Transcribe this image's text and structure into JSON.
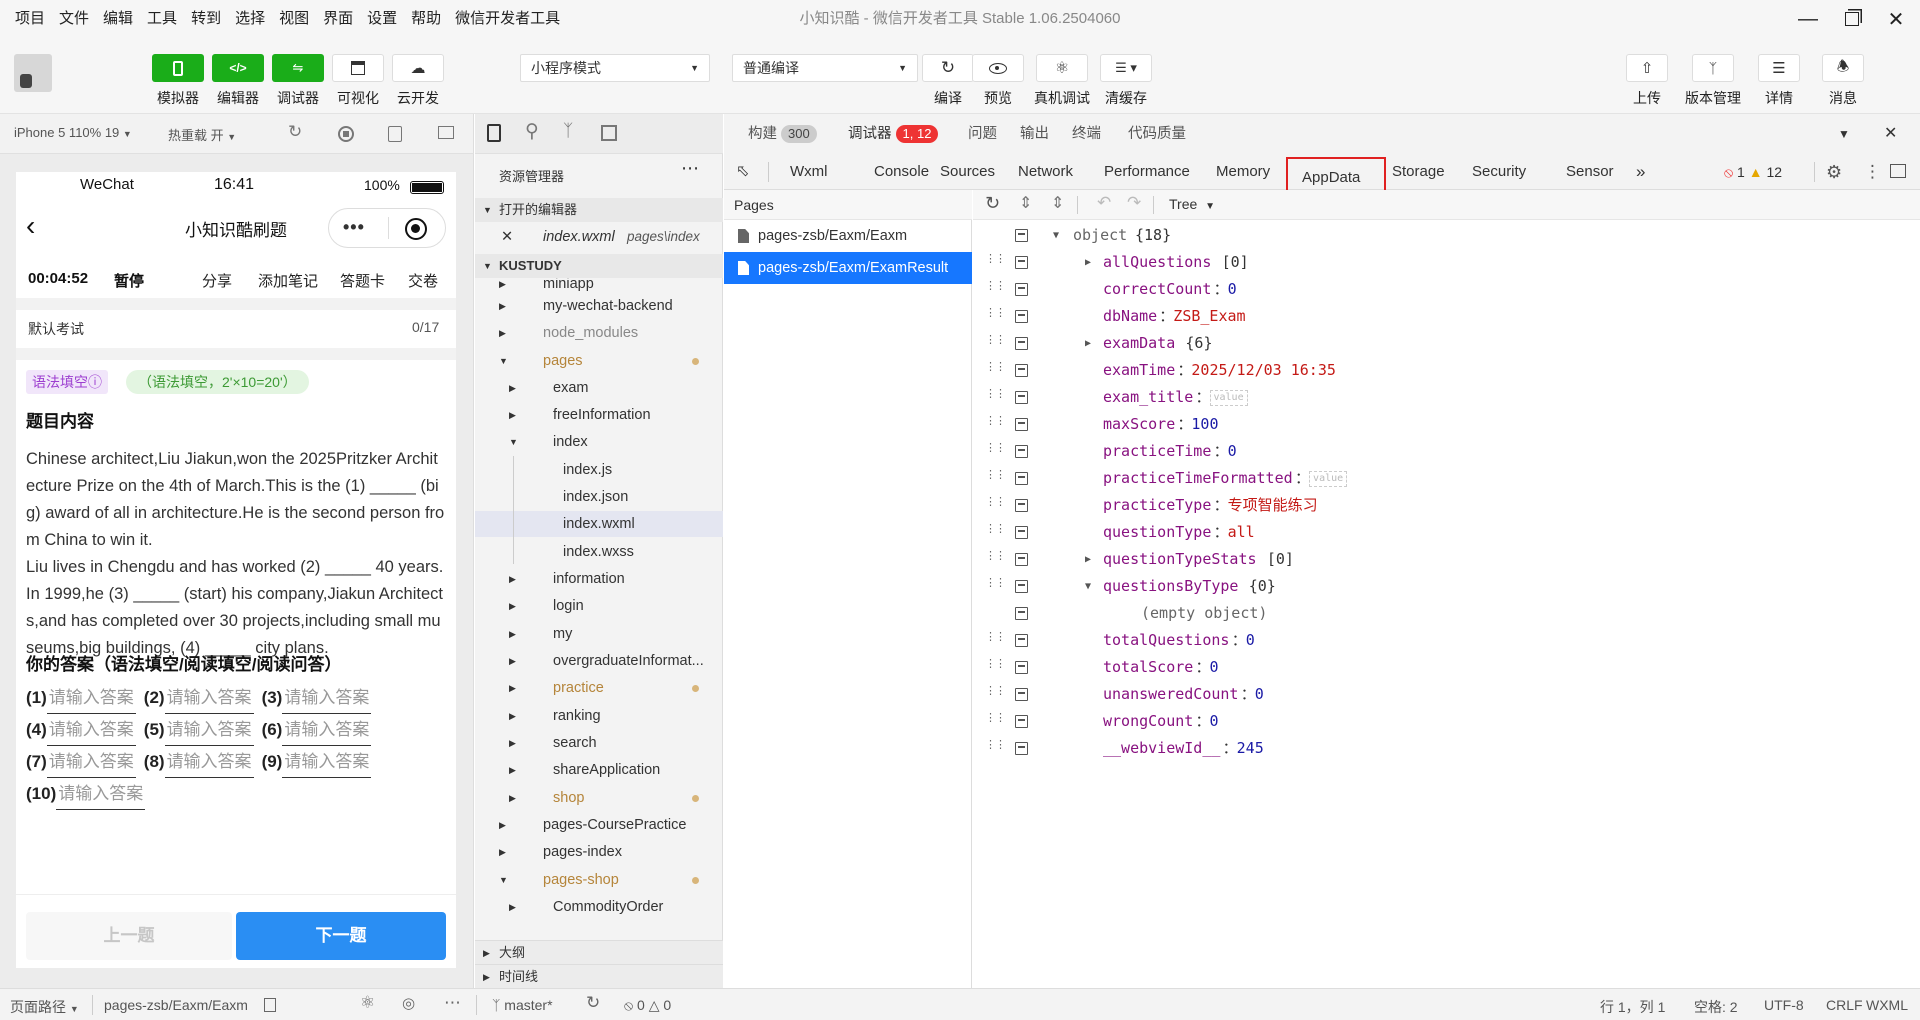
{
  "app": {
    "title": "小知识酷 - 微信开发者工具 Stable 1.06.2504060",
    "menu": [
      "项目",
      "文件",
      "编辑",
      "工具",
      "转到",
      "选择",
      "视图",
      "界面",
      "设置",
      "帮助",
      "微信开发者工具"
    ]
  },
  "toolbar": {
    "left_buttons": [
      "模拟器",
      "编辑器",
      "调试器",
      "可视化",
      "云开发"
    ],
    "mode_select": "小程序模式",
    "compile_select": "普通编译",
    "mid_buttons": [
      "编译",
      "预览",
      "真机调试",
      "清缓存"
    ],
    "right_buttons": [
      "上传",
      "版本管理",
      "详情",
      "消息"
    ]
  },
  "simulator_toolbar": {
    "device": "iPhone 5 110% 19",
    "hot_reload": "热重载 开"
  },
  "phone": {
    "status_app": "WeChat",
    "status_time": "16:41",
    "status_battery": "100%",
    "nav_title": "小知识酷刷题",
    "timer": "00:04:52",
    "pause": "暂停",
    "actions": [
      "分享",
      "添加笔记",
      "答题卡",
      "交卷"
    ],
    "exam_name": "默认考试",
    "exam_progress": "0/17",
    "tag_type": "语法填空ⓘ",
    "tag_desc": "（语法填空，2'×10=20'）",
    "content_heading": "题目内容",
    "para1": "Chinese architect,Liu Jiakun,won the 2025Pritzker Architecture Prize on the 4th of March.This is the (1) _____ (big) award of all in architecture.He is the second person from China to win it.",
    "para2": "Liu lives in Chengdu and has worked (2) _____ 40 years.In 1999,he (3) _____ (start) his company,Jiakun Architects,and has completed over 30 projects,including small museums,big buildings, (4) _____ city plans.",
    "answer_heading": "你的答案（语法填空/阅读填空/阅读问答）",
    "answer_placeholder": "请输入答案",
    "answer_numbers": [
      "(1)",
      "(2)",
      "(3)",
      "(4)",
      "(5)",
      "(6)",
      "(7)",
      "(8)",
      "(9)",
      "(10)"
    ],
    "prev_button": "上一题",
    "next_button": "下一题"
  },
  "explorer": {
    "title": "资源管理器",
    "open_editors": "打开的编辑器",
    "open_file": "index.wxml",
    "open_file_path": "pages\\index",
    "project": "KUSTUDY",
    "items": [
      "miniapp",
      "my-wechat-backend",
      "node_modules",
      "pages",
      "exam",
      "freeInformation",
      "index",
      "index.js",
      "index.json",
      "index.wxml",
      "index.wxss",
      "information",
      "login",
      "my",
      "overgraduateInformat...",
      "practice",
      "ranking",
      "search",
      "shareApplication",
      "shop",
      "pages-CoursePractice",
      "pages-index",
      "pages-shop",
      "CommodityOrder"
    ],
    "outline": "大纲",
    "timeline": "时间线"
  },
  "devtools": {
    "top_tabs": {
      "build": "构建",
      "build_count": "300",
      "debugger": "调试器",
      "debugger_badge": "1, 12",
      "issues": "问题",
      "output": "输出",
      "terminal": "终端",
      "quality": "代码质量"
    },
    "tabs": [
      "Wxml",
      "Console",
      "Sources",
      "Network",
      "Performance",
      "Memory",
      "AppData",
      "Storage",
      "Security",
      "Sensor"
    ],
    "active_tab": "AppData",
    "errors": "1",
    "warnings": "12",
    "pages_label": "Pages",
    "pages": [
      "pages-zsb/Eaxm/Eaxm",
      "pages-zsb/Eaxm/ExamResult"
    ],
    "view_mode": "Tree",
    "root": "object",
    "root_count": "{18}",
    "empty_object": "(empty object)",
    "value_placeholder": "value",
    "fields": [
      {
        "key": "allQuestions",
        "val": "[0]"
      },
      {
        "key": "correctCount",
        "val": "0"
      },
      {
        "key": "dbName",
        "val": "ZSB_Exam"
      },
      {
        "key": "examData",
        "val": "{6}"
      },
      {
        "key": "examTime",
        "val": "2025/12/03 16:35"
      },
      {
        "key": "exam_title",
        "val": ""
      },
      {
        "key": "maxScore",
        "val": "100"
      },
      {
        "key": "practiceTime",
        "val": "0"
      },
      {
        "key": "practiceTimeFormatted",
        "val": ""
      },
      {
        "key": "practiceType",
        "val": "专项智能练习"
      },
      {
        "key": "questionType",
        "val": "all"
      },
      {
        "key": "questionTypeStats",
        "val": "[0]"
      },
      {
        "key": "questionsByType",
        "val": "{0}"
      },
      {
        "key": "totalQuestions",
        "val": "0"
      },
      {
        "key": "totalScore",
        "val": "0"
      },
      {
        "key": "unansweredCount",
        "val": "0"
      },
      {
        "key": "wrongCount",
        "val": "0"
      },
      {
        "key": "__webviewId__",
        "val": "245"
      }
    ]
  },
  "statusbar": {
    "page_path_label": "页面路径",
    "page_path": "pages-zsb/Eaxm/Eaxm",
    "branch": "master*",
    "problems": "0",
    "warnings": "0",
    "cursor": "行 1，列 1",
    "spaces": "空格: 2",
    "encoding": "UTF-8",
    "eol": "CRLF",
    "language": "WXML"
  },
  "colors": {
    "accent_green": "#1aad19",
    "highlight": "#e02020",
    "selected_page": "#1677ff",
    "next_button": "#2a8ef3"
  }
}
